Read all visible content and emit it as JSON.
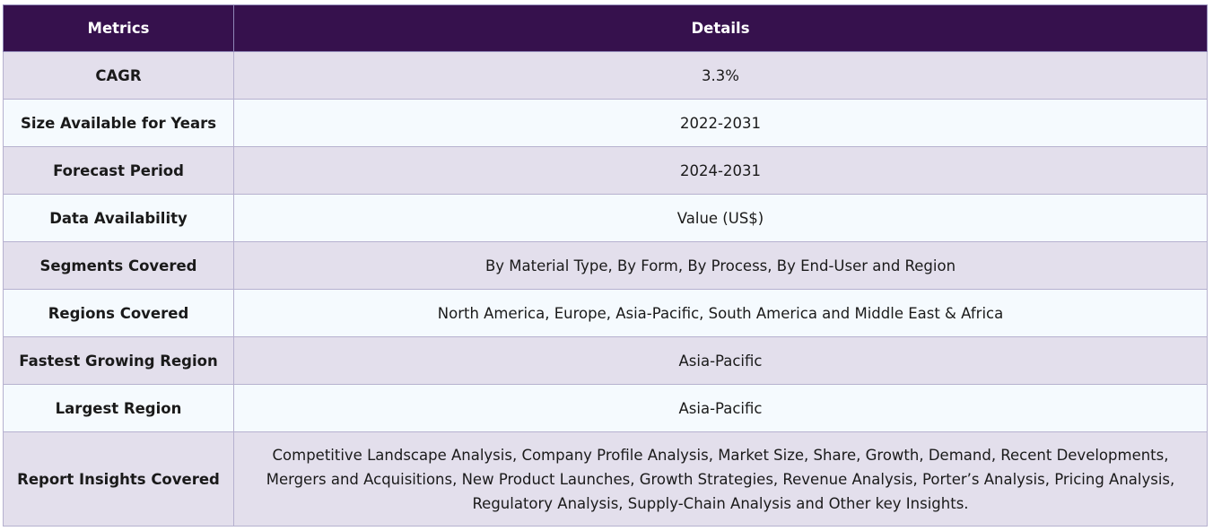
{
  "table": {
    "headers": {
      "metric": "Metrics",
      "details": "Details"
    },
    "rows": [
      {
        "metric": "CAGR",
        "details": "3.3%"
      },
      {
        "metric": "Size Available for Years",
        "details": "2022-2031"
      },
      {
        "metric": "Forecast Period",
        "details": "2024-2031"
      },
      {
        "metric": "Data Availability",
        "details": "Value (US$)"
      },
      {
        "metric": "Segments Covered",
        "details": "By Material Type, By Form, By Process, By End-User and Region"
      },
      {
        "metric": "Regions Covered",
        "details": "North America, Europe, Asia-Pacific, South America and Middle East & Africa"
      },
      {
        "metric": "Fastest Growing Region",
        "details": "Asia-Pacific"
      },
      {
        "metric": "Largest Region",
        "details": "Asia-Pacific"
      },
      {
        "metric": "Report Insights Covered",
        "details": "Competitive Landscape Analysis, Company Profile Analysis, Market Size, Share, Growth, Demand, Recent Developments, Mergers and Acquisitions, New Product Launches, Growth Strategies, Revenue Analysis, Porter’s Analysis, Pricing Analysis, Regulatory Analysis, Supply-Chain Analysis and Other key Insights."
      }
    ]
  }
}
